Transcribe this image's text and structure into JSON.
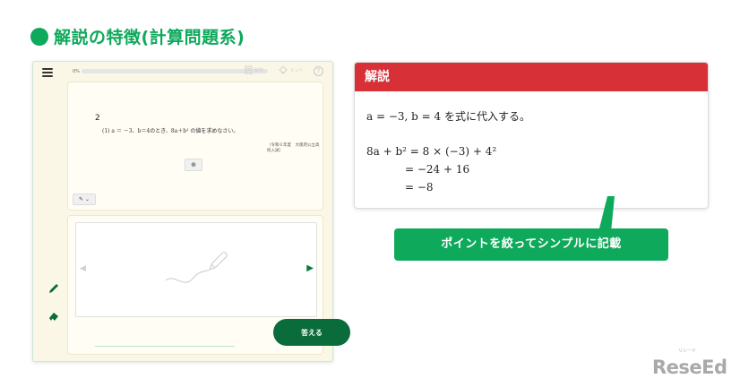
{
  "page_title": "解説の特徴(計算問題系)",
  "app": {
    "progress": {
      "label": "0%",
      "value": 0
    },
    "toolbar": {
      "explain_label": "解説",
      "hint_label": "ヒント"
    },
    "question": {
      "number": "2",
      "text": "(1)  a ＝ －3、b＝4のとき、8a＋b² の値を求めなさい。",
      "source": "〔令和６年度　大阪府公立高校入試〕"
    },
    "answer_button": "答える"
  },
  "explanation": {
    "header": "解説",
    "line1": "a = −3, b = 4 を式に代入する。",
    "steps": [
      "8a + b² = 8 × (−3) + 4²",
      "= −24 + 16",
      "= −8"
    ]
  },
  "callout": "ポイントを絞ってシンプルに記載",
  "logo": {
    "text": "ReseEd",
    "kana": "リシード"
  },
  "colors": {
    "brand_green": "#0fa95b",
    "dark_green": "#0a6b3b",
    "header_red": "#d73137",
    "app_bg": "#fbf7e6"
  }
}
